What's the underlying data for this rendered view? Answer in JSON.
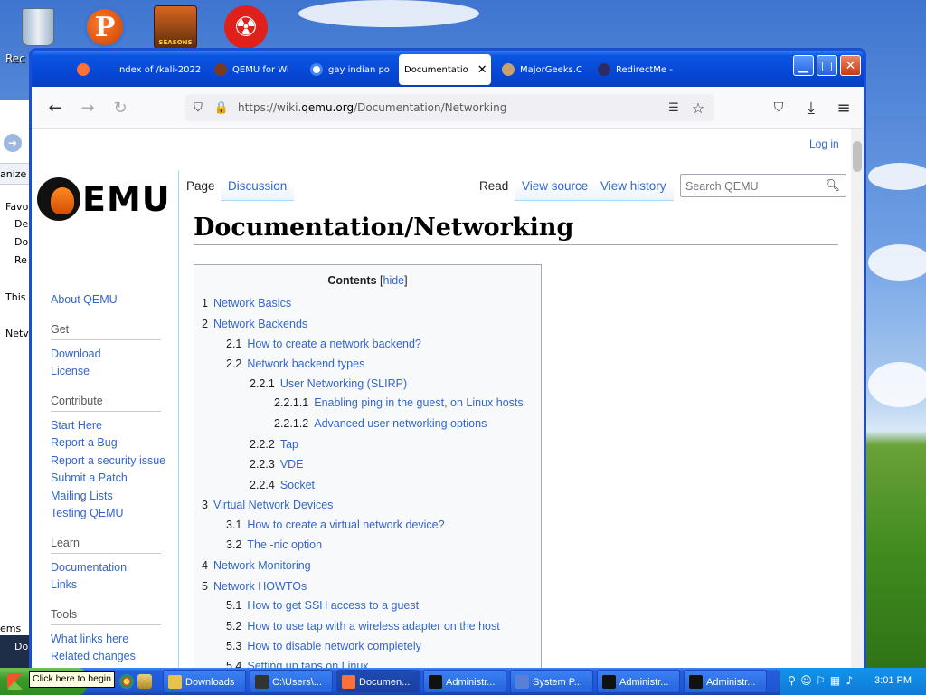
{
  "desktop": {
    "recycle_label": "Rec",
    "p_icon_letter": "P",
    "seasons_label": "SEASONS",
    "explorer_rows": [
      "anize",
      "Favo",
      "De",
      "Do",
      "Re",
      "This",
      "Netv",
      "ems",
      "Do"
    ]
  },
  "browser": {
    "tabs": [
      {
        "label": "",
        "fav_color": "#ff7139"
      },
      {
        "label": "Index of /kali-2022",
        "fav_color": ""
      },
      {
        "label": "QEMU for Wi",
        "fav_color": "#7a3b1a"
      },
      {
        "label": "gay indian po",
        "fav_color": "#4285f4"
      },
      {
        "label": "Documentatio",
        "fav_color": "",
        "close": "✕"
      },
      {
        "label": "MajorGeeks.C",
        "fav_color": "#c9a070"
      },
      {
        "label": "RedirectMe -",
        "fav_color": "#2b2b66"
      }
    ],
    "window_buttons": {
      "min": "▁",
      "max": "□",
      "close": "✕"
    },
    "url_prefix": "https://wiki.",
    "url_domain": "qemu.org",
    "url_path": "/Documentation/Networking",
    "icons": {
      "back": "←",
      "forward": "→",
      "reload": "↻",
      "shield": "⛉",
      "lock": "🔒",
      "reader": "☰",
      "star": "☆",
      "pocket": "⛉",
      "download": "⤓",
      "menu": "≡"
    }
  },
  "page": {
    "login": "Log in",
    "logo_word": "EMU",
    "sidebar": {
      "about": "About QEMU",
      "groups": [
        {
          "heading": "Get",
          "links": [
            "Download",
            "License"
          ]
        },
        {
          "heading": "Contribute",
          "links": [
            "Start Here",
            "Report a Bug",
            "Report a security issue",
            "Submit a Patch",
            "Mailing Lists",
            "Testing QEMU"
          ]
        },
        {
          "heading": "Learn",
          "links": [
            "Documentation",
            "Links"
          ]
        },
        {
          "heading": "Tools",
          "links": [
            "What links here",
            "Related changes"
          ]
        }
      ]
    },
    "tabs": {
      "page": "Page",
      "discussion": "Discussion",
      "read": "Read",
      "view_source": "View source",
      "view_history": "View history"
    },
    "search_placeholder": "Search QEMU",
    "title": "Documentation/Networking",
    "toc": {
      "title": "Contents",
      "hide_open": "[",
      "hide": "hide",
      "hide_close": "]",
      "items": [
        {
          "num": "1",
          "text": "Network Basics",
          "level": 1
        },
        {
          "num": "2",
          "text": "Network Backends",
          "level": 1
        },
        {
          "num": "2.1",
          "text": "How to create a network backend?",
          "level": 2
        },
        {
          "num": "2.2",
          "text": "Network backend types",
          "level": 2
        },
        {
          "num": "2.2.1",
          "text": "User Networking (SLIRP)",
          "level": 3
        },
        {
          "num": "2.2.1.1",
          "text": "Enabling ping in the guest, on Linux hosts",
          "level": 4
        },
        {
          "num": "2.2.1.2",
          "text": "Advanced user networking options",
          "level": 4
        },
        {
          "num": "2.2.2",
          "text": "Tap",
          "level": 3
        },
        {
          "num": "2.2.3",
          "text": "VDE",
          "level": 3
        },
        {
          "num": "2.2.4",
          "text": "Socket",
          "level": 3
        },
        {
          "num": "3",
          "text": "Virtual Network Devices",
          "level": 1
        },
        {
          "num": "3.1",
          "text": "How to create a virtual network device?",
          "level": 2
        },
        {
          "num": "3.2",
          "text": "The -nic option",
          "level": 2
        },
        {
          "num": "4",
          "text": "Network Monitoring",
          "level": 1
        },
        {
          "num": "5",
          "text": "Network HOWTOs",
          "level": 1
        },
        {
          "num": "5.1",
          "text": "How to get SSH access to a guest",
          "level": 2
        },
        {
          "num": "5.2",
          "text": "How to use tap with a wireless adapter on the host",
          "level": 2
        },
        {
          "num": "5.3",
          "text": "How to disable network completely",
          "level": 2
        },
        {
          "num": "5.4",
          "text": "Setting up taps on Linux",
          "level": 2
        }
      ]
    }
  },
  "taskbar": {
    "tooltip": "Click here to begin",
    "buttons": [
      {
        "label": "Downloads",
        "color": "#e8c34a"
      },
      {
        "label": "C:\\Users\\...",
        "color": "#333"
      },
      {
        "label": "Documen...",
        "color": "#ff7139",
        "active": true
      },
      {
        "label": "Administr...",
        "color": "#111"
      },
      {
        "label": "System P...",
        "color": "#5a7fd6"
      },
      {
        "label": "Administr...",
        "color": "#111"
      },
      {
        "label": "Administr...",
        "color": "#111"
      }
    ],
    "clock": "3:01 PM"
  }
}
